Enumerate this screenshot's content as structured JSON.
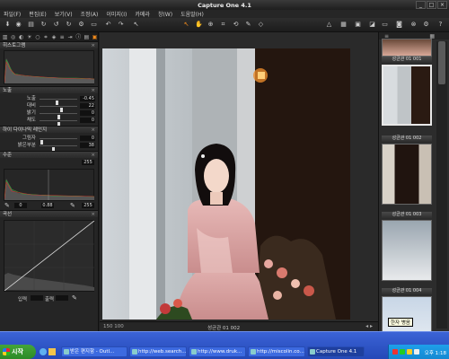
{
  "window": {
    "title": "Capture One 4.1"
  },
  "menu": [
    "파일(F)",
    "편집(E)",
    "보기(V)",
    "조정(A)",
    "이미지(I)",
    "카메라",
    "창(W)",
    "도움말(H)"
  ],
  "left_panel": {
    "histogram_title": "히스토그램",
    "exposure": {
      "title": "노출",
      "rows": [
        {
          "label": "노출",
          "value": "-0.45",
          "pos": 0.45
        },
        {
          "label": "대비",
          "value": "22",
          "pos": 0.55
        },
        {
          "label": "밝기",
          "value": "0",
          "pos": 0.5
        },
        {
          "label": "채도",
          "value": "0",
          "pos": 0.5
        }
      ]
    },
    "hdr": {
      "title": "하이 다이나믹 레인지",
      "rows": [
        {
          "label": "그림자",
          "value": "0",
          "pos": 0.05
        },
        {
          "label": "밝은부분",
          "value": "38",
          "pos": 0.35
        }
      ]
    },
    "levels": {
      "title": "수준",
      "top_right": "255",
      "low": "0",
      "mid": "0.88",
      "high": "255"
    },
    "curve": {
      "title": "곡선",
      "input_label": "입력",
      "output_label": "출력"
    }
  },
  "viewer": {
    "zoom": "150 100",
    "filename": "성균관 01 002"
  },
  "browser": {
    "thumbs": [
      {
        "caption": "성균관 01 001"
      },
      {
        "caption": "성균관 01 002"
      },
      {
        "caption": "성균관 01 003"
      },
      {
        "caption": "성균관 01 004"
      }
    ],
    "tooltip": "한자 병음"
  },
  "taskbar": {
    "start": "시작",
    "tasks": [
      {
        "label": "받은 편지함 - Outl..."
      },
      {
        "label": "http://web.search..."
      },
      {
        "label": "http://www.druk..."
      },
      {
        "label": "http://miscolin.co..."
      },
      {
        "label": "Capture One 4.1"
      }
    ],
    "clock": "오후 1:18"
  },
  "colors": {
    "accent": "#f08a1c",
    "panel": "#252525",
    "taskbar": "#2448b8",
    "start": "#3a9a30"
  },
  "icons": [
    "import-icon",
    "capture-icon",
    "undo-icon",
    "redo-icon",
    "rotate-left-icon",
    "rotate-right-icon",
    "crop-icon",
    "zoom-icon",
    "hand-icon",
    "eyedropper-icon",
    "warning-icon",
    "settings-icon"
  ]
}
